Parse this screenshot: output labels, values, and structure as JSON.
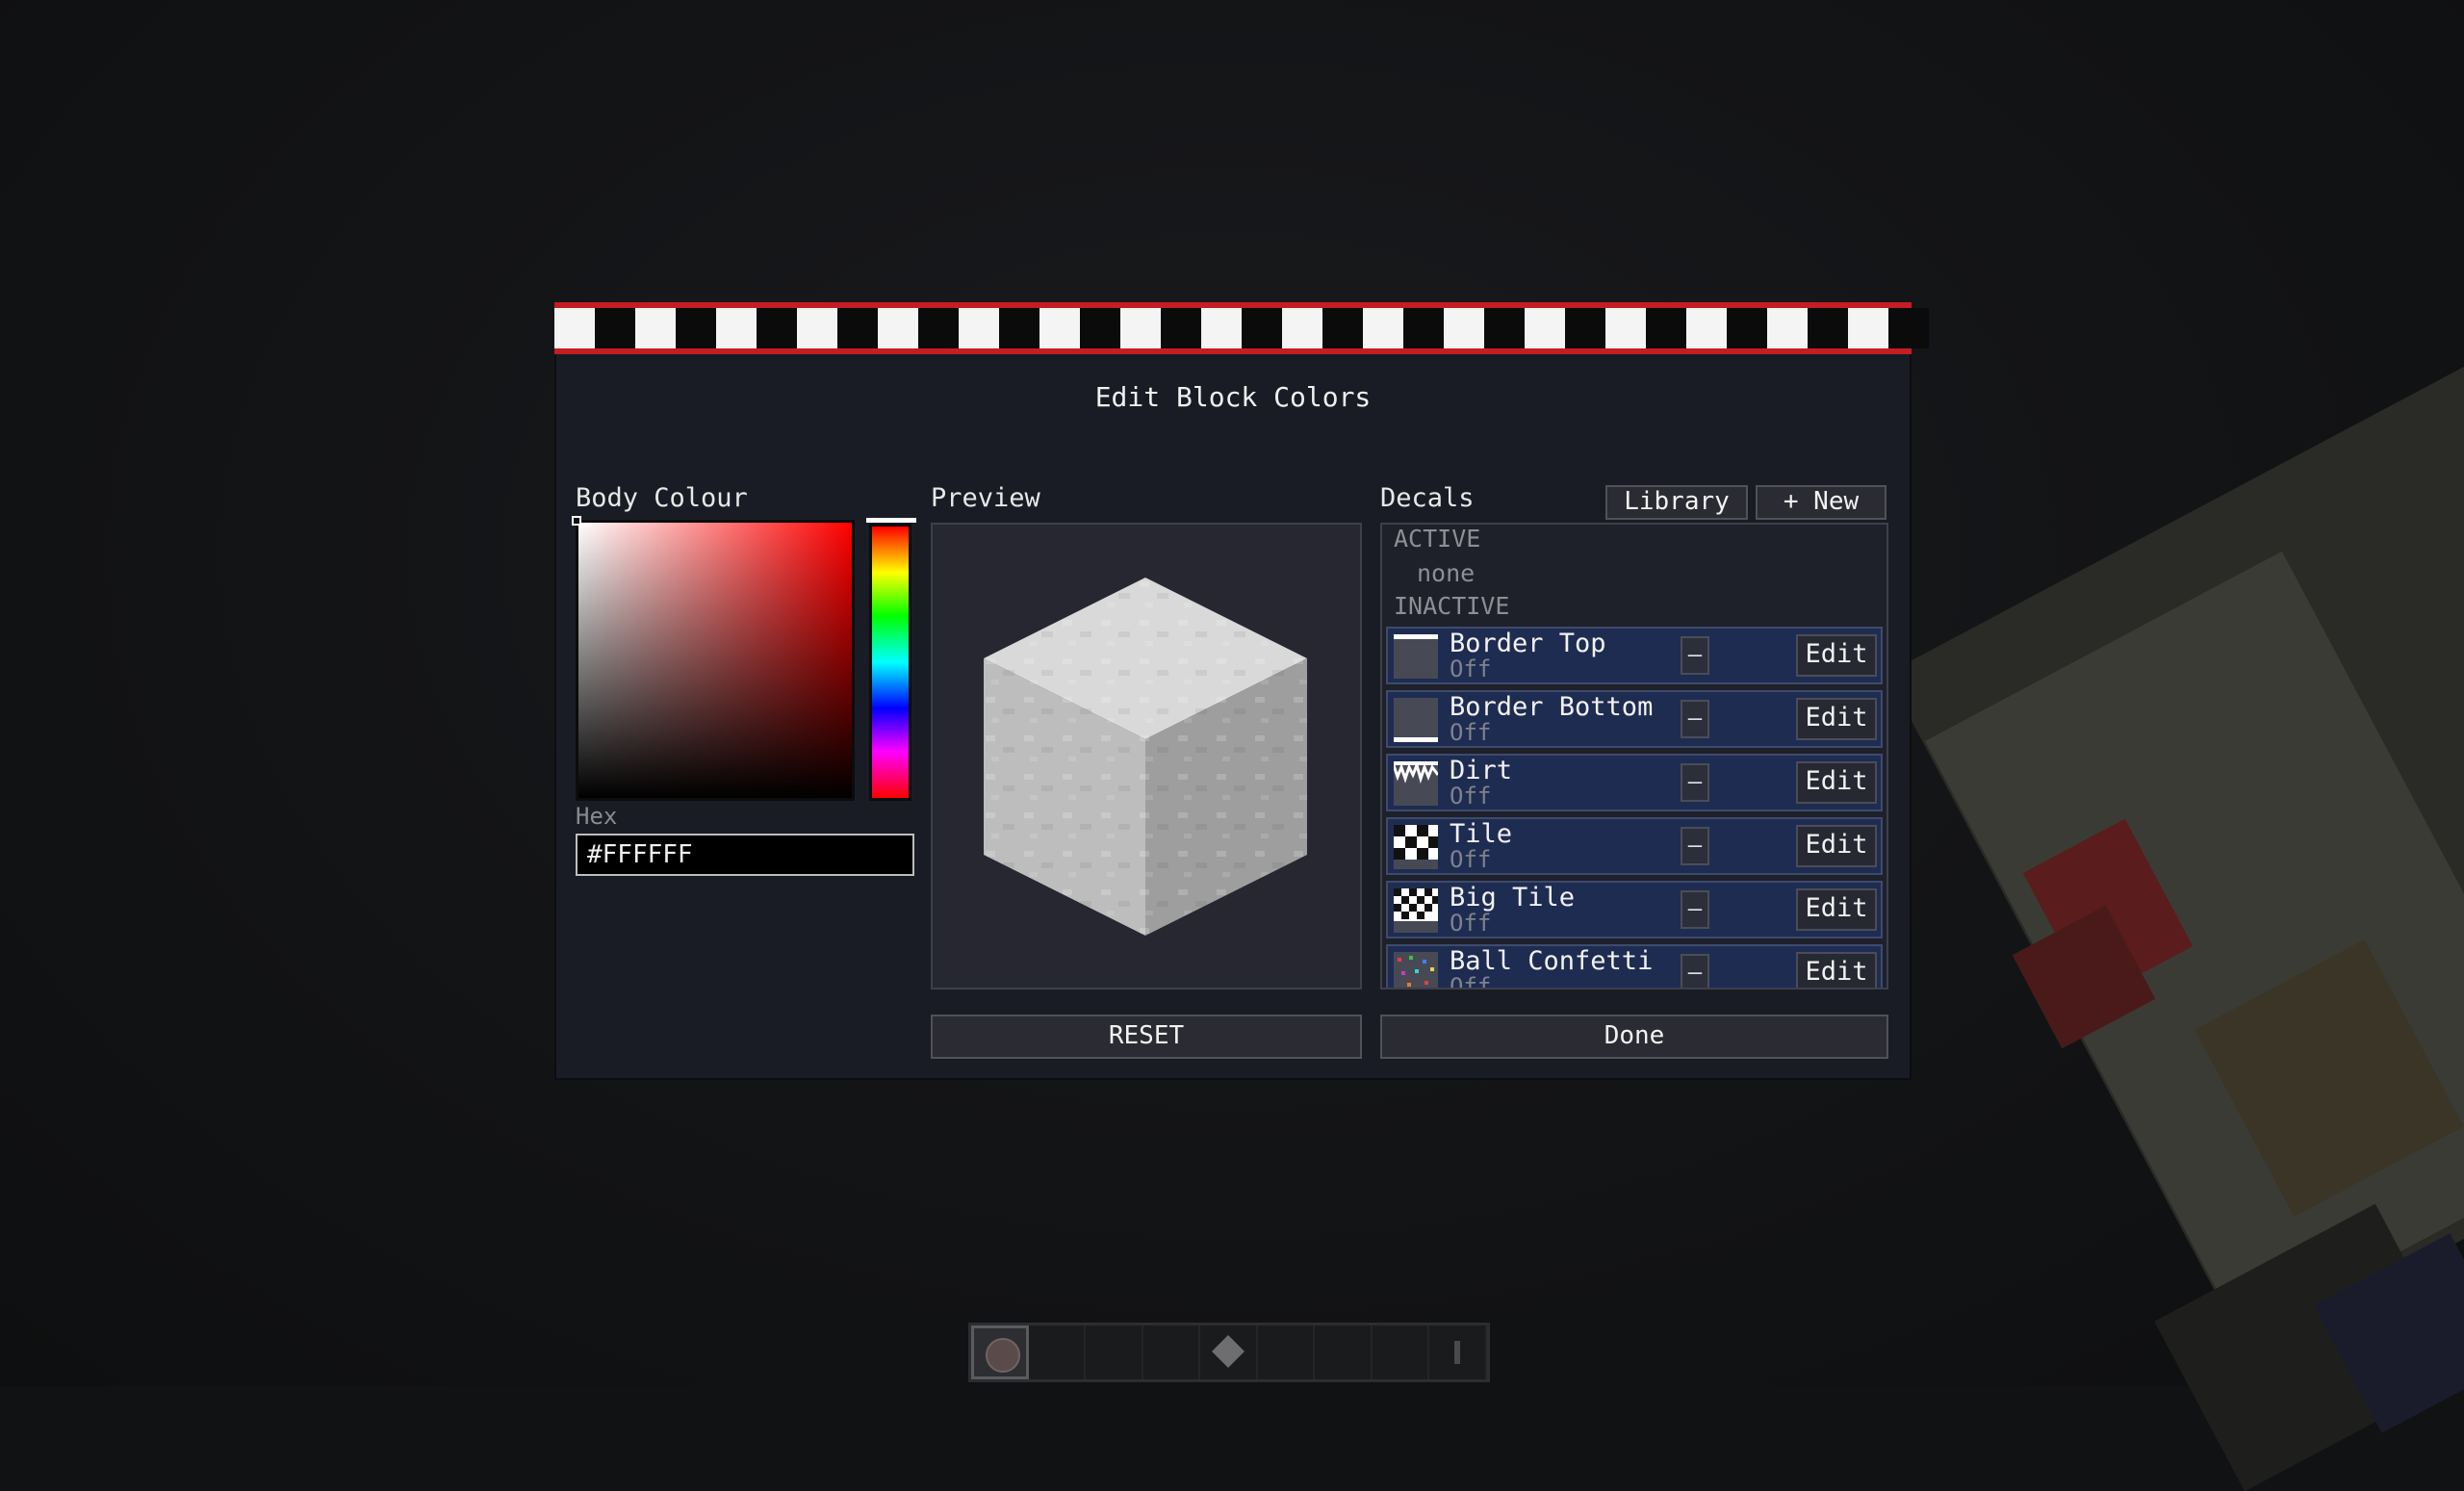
{
  "window": {
    "title": "Edit Block Colors"
  },
  "colors": {
    "banner_red": "#c61d23",
    "panel_bg": "#1a1c25",
    "row_bg": "#1f2c52",
    "body_color": "#FFFFFF"
  },
  "body_colour": {
    "label": "Body Colour",
    "hex_label": "Hex",
    "hex_value": "#FFFFFF",
    "hue_level": 0.0
  },
  "preview": {
    "label": "Preview",
    "reset_label": "RESET"
  },
  "decals": {
    "label": "Decals",
    "library_label": "Library",
    "new_label": "+ New",
    "active_header": "ACTIVE",
    "active_empty": "none",
    "inactive_header": "INACTIVE",
    "items": [
      {
        "name": "Border Top",
        "state": "Off",
        "minus": "–",
        "edit": "Edit",
        "icon": "border-top-thumb"
      },
      {
        "name": "Border Bottom",
        "state": "Off",
        "minus": "–",
        "edit": "Edit",
        "icon": "border-bottom-thumb"
      },
      {
        "name": "Dirt",
        "state": "Off",
        "minus": "–",
        "edit": "Edit",
        "icon": "dirt-thumb"
      },
      {
        "name": "Tile",
        "state": "Off",
        "minus": "–",
        "edit": "Edit",
        "icon": "tile-thumb"
      },
      {
        "name": "Big Tile",
        "state": "Off",
        "minus": "–",
        "edit": "Edit",
        "icon": "big-tile-thumb"
      },
      {
        "name": "Ball Confetti",
        "state": "Off",
        "minus": "–",
        "edit": "Edit",
        "icon": "ball-confetti-thumb"
      }
    ]
  },
  "footer": {
    "done_label": "Done"
  },
  "hotbar": {
    "slots": 9,
    "selected": 0
  }
}
